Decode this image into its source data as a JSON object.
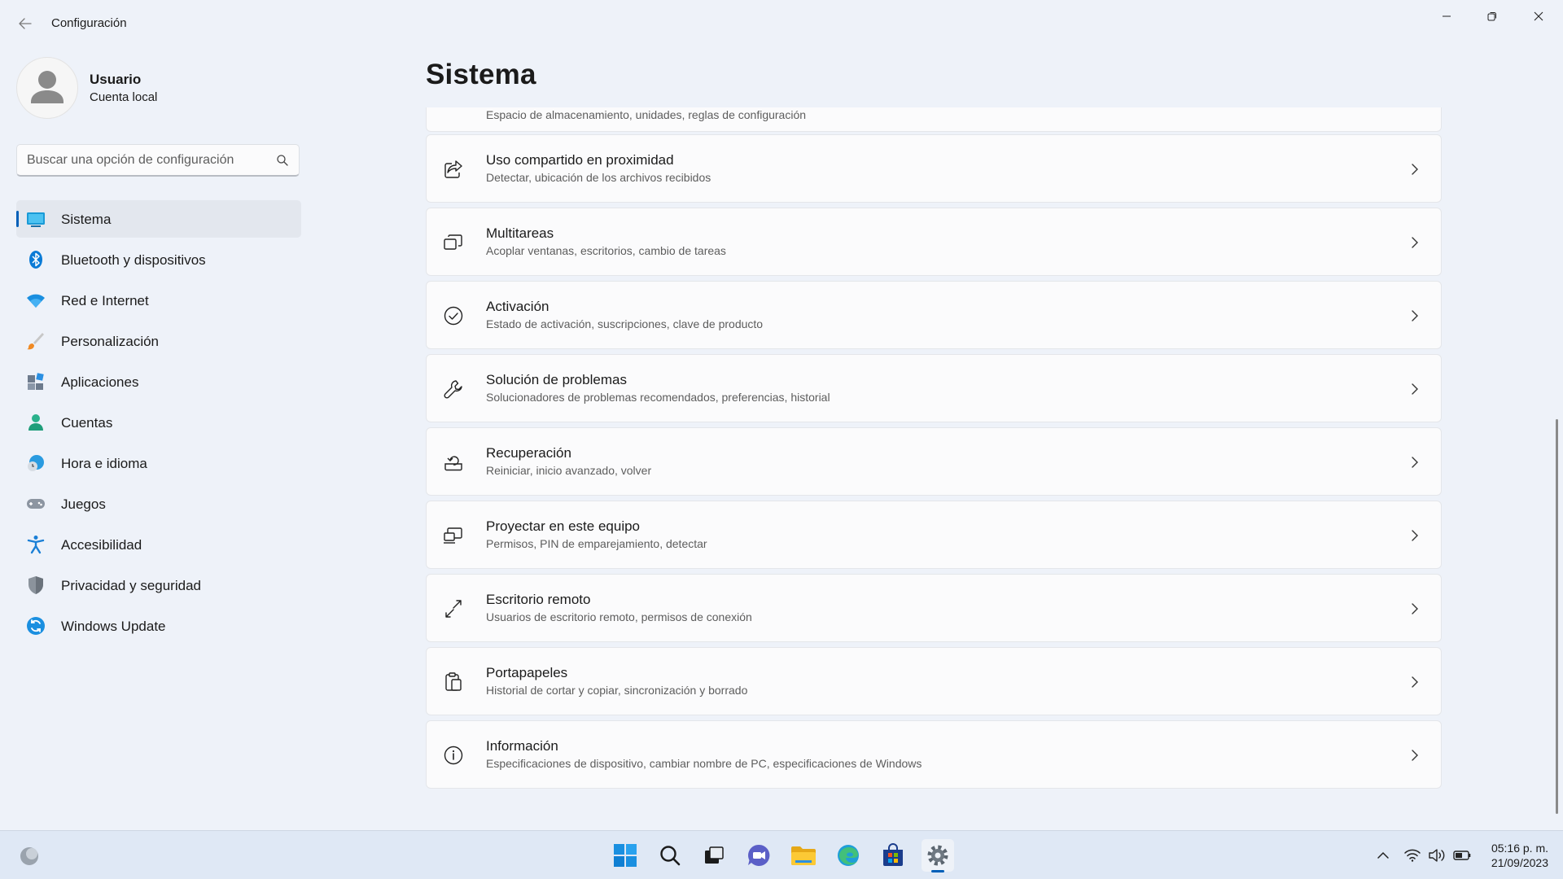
{
  "window": {
    "title": "Configuración"
  },
  "profile": {
    "name": "Usuario",
    "account_type": "Cuenta local"
  },
  "search": {
    "placeholder": "Buscar una opción de configuración"
  },
  "sidebar": {
    "items": [
      {
        "label": "Sistema",
        "icon": "system-icon",
        "active": true
      },
      {
        "label": "Bluetooth y dispositivos",
        "icon": "bluetooth-icon"
      },
      {
        "label": "Red e Internet",
        "icon": "wifi-icon"
      },
      {
        "label": "Personalización",
        "icon": "brush-icon"
      },
      {
        "label": "Aplicaciones",
        "icon": "apps-icon"
      },
      {
        "label": "Cuentas",
        "icon": "accounts-icon"
      },
      {
        "label": "Hora e idioma",
        "icon": "time-language-icon"
      },
      {
        "label": "Juegos",
        "icon": "gamepad-icon"
      },
      {
        "label": "Accesibilidad",
        "icon": "accessibility-icon"
      },
      {
        "label": "Privacidad y seguridad",
        "icon": "shield-icon"
      },
      {
        "label": "Windows Update",
        "icon": "update-icon"
      }
    ]
  },
  "main": {
    "title": "Sistema",
    "partial_card_subtitle": "Espacio de almacenamiento, unidades, reglas de configuración",
    "cards": [
      {
        "title": "Uso compartido en proximidad",
        "subtitle": "Detectar, ubicación de los archivos recibidos",
        "icon": "share-icon"
      },
      {
        "title": "Multitareas",
        "subtitle": "Acoplar ventanas, escritorios, cambio de tareas",
        "icon": "multitask-icon"
      },
      {
        "title": "Activación",
        "subtitle": "Estado de activación, suscripciones, clave de producto",
        "icon": "check-circle-icon"
      },
      {
        "title": "Solución de problemas",
        "subtitle": "Solucionadores de problemas recomendados, preferencias, historial",
        "icon": "wrench-icon"
      },
      {
        "title": "Recuperación",
        "subtitle": "Reiniciar, inicio avanzado, volver",
        "icon": "recovery-icon"
      },
      {
        "title": "Proyectar en este equipo",
        "subtitle": "Permisos, PIN de emparejamiento, detectar",
        "icon": "project-icon"
      },
      {
        "title": "Escritorio remoto",
        "subtitle": "Usuarios de escritorio remoto, permisos de conexión",
        "icon": "remote-desktop-icon"
      },
      {
        "title": "Portapapeles",
        "subtitle": "Historial de cortar y copiar, sincronización y borrado",
        "icon": "clipboard-icon"
      },
      {
        "title": "Información",
        "subtitle": "Especificaciones de dispositivo, cambiar nombre de PC, especificaciones de Windows",
        "icon": "info-icon"
      }
    ]
  },
  "taskbar": {
    "time": "05:16 p. m.",
    "date": "21/09/2023",
    "colors": {
      "accent": "#005fb8"
    }
  }
}
